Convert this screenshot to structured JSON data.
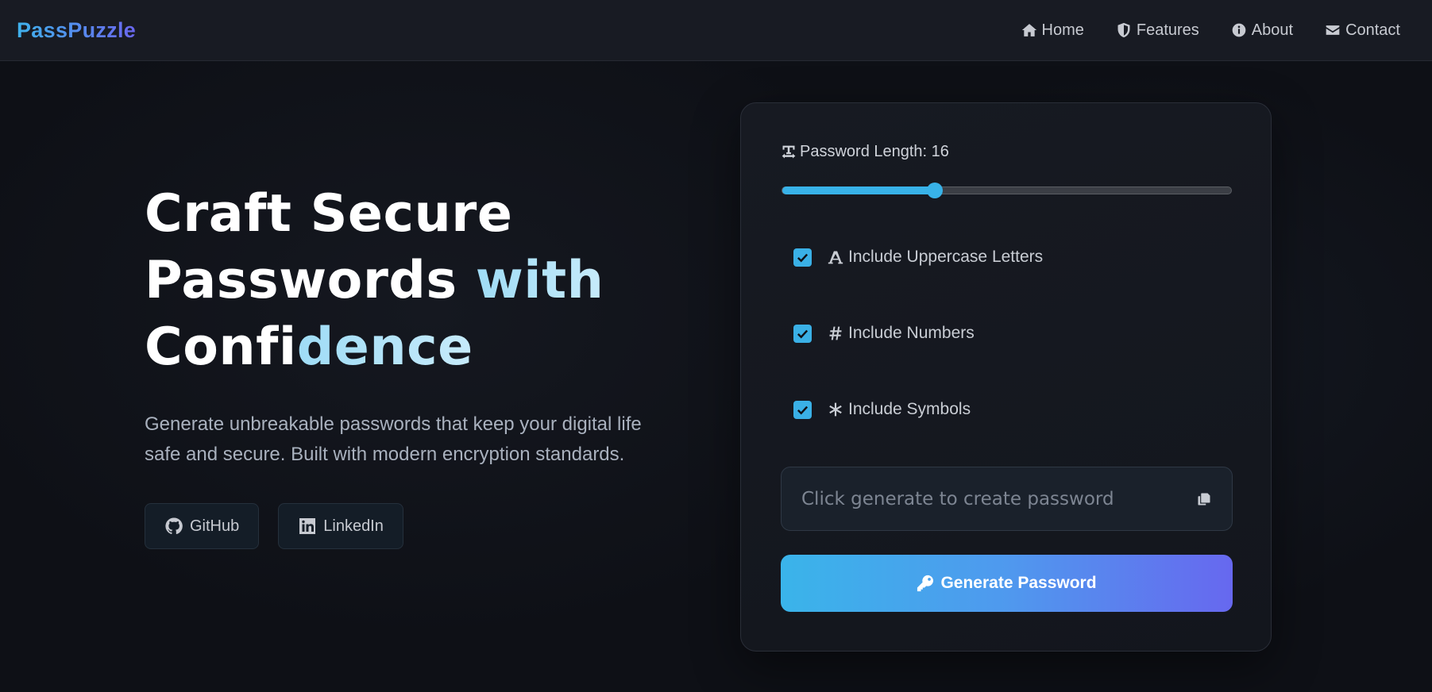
{
  "brand": {
    "name": "PassPuzzle",
    "colors": [
      "#3fb2ec",
      "#6a67ef"
    ]
  },
  "nav": {
    "items": [
      {
        "label": "Home",
        "icon": "home-icon"
      },
      {
        "label": "Features",
        "icon": "shield-icon"
      },
      {
        "label": "About",
        "icon": "info-circle-icon"
      },
      {
        "label": "Contact",
        "icon": "envelope-icon"
      }
    ]
  },
  "hero": {
    "title_line1": "Craft Secure",
    "title_line2_a": "Passwords ",
    "title_line2_b": "with",
    "title_line3_a": "Confi",
    "title_line3_b": "dence",
    "subtitle": "Generate unbreakable passwords that keep your digital life safe and secure. Built with modern encryption standards.",
    "buttons": [
      {
        "label": "GitHub",
        "icon": "github-icon"
      },
      {
        "label": "LinkedIn",
        "icon": "linkedin-icon"
      }
    ]
  },
  "generator": {
    "length_label": "Password Length: 16",
    "length": {
      "value": 16,
      "min": 8,
      "max": 32,
      "fill_fraction": 0.34
    },
    "options": [
      {
        "label": "Include Uppercase Letters",
        "checked": true,
        "icon": "text-height-icon"
      },
      {
        "label": "Include Numbers",
        "checked": true,
        "icon": "hashtag-icon"
      },
      {
        "label": "Include Symbols",
        "checked": true,
        "icon": "asterisk-icon"
      }
    ],
    "password_placeholder": "Click generate to create password",
    "copy_icon": "copy-icon",
    "generate_label": "Generate Password",
    "generate_icon": "key-icon",
    "accent": "#38b2e8"
  }
}
